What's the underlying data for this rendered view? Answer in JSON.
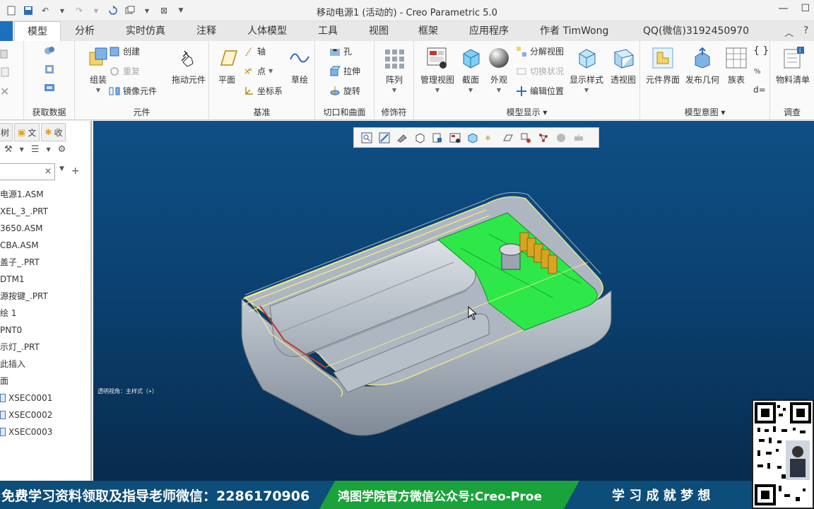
{
  "window": {
    "title": "移动电源1 (活动的) - Creo Parametric 5.0"
  },
  "tabs": [
    {
      "label": "模型",
      "active": true
    },
    {
      "label": "分析"
    },
    {
      "label": "实时仿真"
    },
    {
      "label": "注释"
    },
    {
      "label": "人体模型"
    },
    {
      "label": "工具"
    },
    {
      "label": "视图"
    },
    {
      "label": "框架"
    },
    {
      "label": "应用程序"
    },
    {
      "label": "作者 TimWong"
    },
    {
      "label": "QQ(微信)3192450970"
    }
  ],
  "ribbon": {
    "groups": {
      "get_data": "获取数据",
      "component": "元件",
      "datum": "基准",
      "cut_surface": "切口和曲面",
      "modifier": "修饰符",
      "model_display": "模型显示",
      "model_intent": "模型意图",
      "investigate": "调查"
    },
    "buttons": {
      "assemble": "组装",
      "create": "创建",
      "repeat": "重复",
      "mirror_component": "镜像元件",
      "drag_component": "拖动元件",
      "plane": "平面",
      "axis": "轴",
      "point": "点",
      "csys": "坐标系",
      "sketch": "草绘",
      "hole": "孔",
      "extrude": "拉伸",
      "revolve": "旋转",
      "pattern": "阵列",
      "manage_views": "管理视图",
      "section": "截面",
      "appearance": "外观",
      "explode_view": "分解视图",
      "toggle_state": "切换状况",
      "edit_position": "编辑位置",
      "display_style": "显示样式",
      "perspective": "透视图",
      "component_interface": "元件界面",
      "publish_geometry": "发布几何",
      "family_table": "族表",
      "bom": "物料清单",
      "d_equals": "d="
    }
  },
  "left_panel": {
    "tabs": [
      "树",
      "文",
      "收"
    ],
    "search_placeholder": "",
    "tree": [
      "电源1.ASM",
      "XEL_3_.PRT",
      "3650.ASM",
      "CBA.ASM",
      "盖子_.PRT",
      "DTM1",
      "源按键_.PRT",
      "绘 1",
      "PNT0",
      "示灯_.PRT",
      "此插入",
      "面",
      "XSEC0001",
      "XSEC0002",
      "XSEC0003"
    ]
  },
  "viewport": {
    "note": "透明视角：主样式（+）",
    "colors": {
      "background_top": "#0e4f84",
      "background_bottom": "#082b4d",
      "pcb_green": "#2ee84a",
      "body_gray": "#b9c2cc",
      "highlight_yellow": "#f5f08a"
    }
  },
  "banner": {
    "left_text": "免费学习资料领取及指导老师微信：2286170906",
    "middle_text": "鸿图学院官方微信公众号:Creo-Proe",
    "right_text": "学 习 成 就 梦 想",
    "colors": {
      "bar": "#0c4d7a",
      "green": "#1aa33a"
    }
  }
}
